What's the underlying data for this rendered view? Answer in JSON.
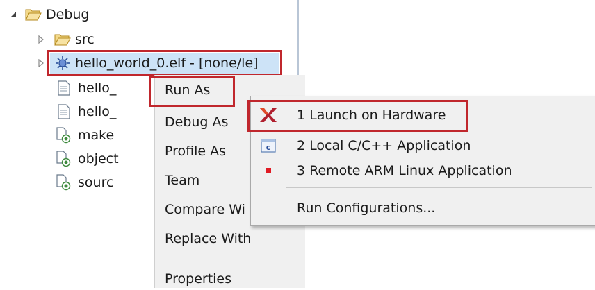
{
  "tree": {
    "root": {
      "label": "Debug",
      "expanded": true
    },
    "items": [
      {
        "label": "src",
        "kind": "folder"
      },
      {
        "label": "hello_world_0.elf - [none/le]",
        "kind": "binary",
        "selected": true
      },
      {
        "label": "hello_",
        "kind": "file"
      },
      {
        "label": "hello_",
        "kind": "file"
      },
      {
        "label": "make",
        "kind": "makefile"
      },
      {
        "label": "object",
        "kind": "makefile"
      },
      {
        "label": "sourc",
        "kind": "makefile"
      }
    ]
  },
  "context_menu": {
    "items": [
      {
        "label": "Run As",
        "highlighted": true
      },
      {
        "label": "Debug As"
      },
      {
        "label": "Profile As"
      },
      {
        "label": "Team"
      },
      {
        "label": "Compare Wi"
      },
      {
        "label": "Replace With"
      },
      {
        "label": "Properties"
      }
    ]
  },
  "submenu": {
    "items": [
      {
        "label": "1 Launch on Hardware",
        "icon": "xilinx-logo-icon",
        "highlighted": true
      },
      {
        "label": "2 Local C/C++ Application",
        "icon": "c-application-icon"
      },
      {
        "label": "3 Remote ARM Linux Application",
        "icon": "red-square-icon"
      },
      {
        "label": "Run Configurations...",
        "icon": ""
      }
    ]
  },
  "colors": {
    "highlight_border": "#c0272d",
    "menu_bg": "#f0f0f0",
    "selection_bg": "#cde3f7",
    "folder_yellow": "#e8c25a"
  }
}
